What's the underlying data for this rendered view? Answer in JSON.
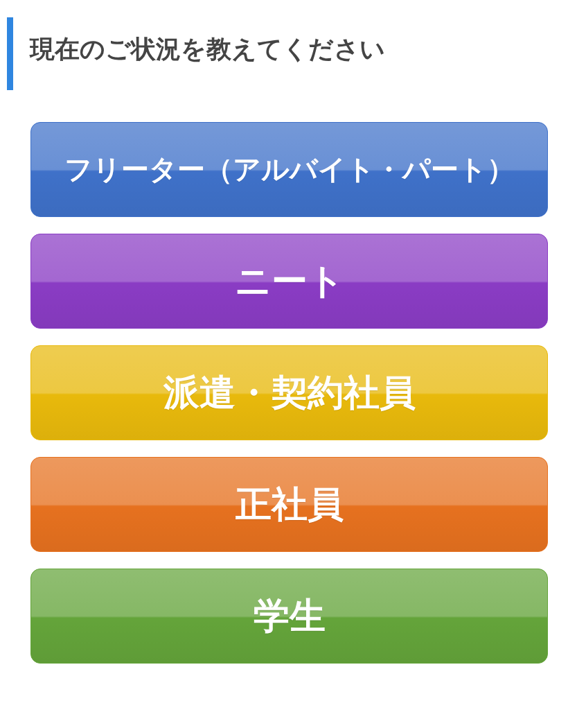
{
  "heading": "現在のご状況を教えてください",
  "options": [
    {
      "label": "フリーター（アルバイト・パート）",
      "color": "#3f71c9"
    },
    {
      "label": "ニート",
      "color": "#8a3cc4"
    },
    {
      "label": "派遣・契約社員",
      "color": "#e8b90c"
    },
    {
      "label": "正社員",
      "color": "#e6711f"
    },
    {
      "label": "学生",
      "color": "#64a43a"
    }
  ]
}
